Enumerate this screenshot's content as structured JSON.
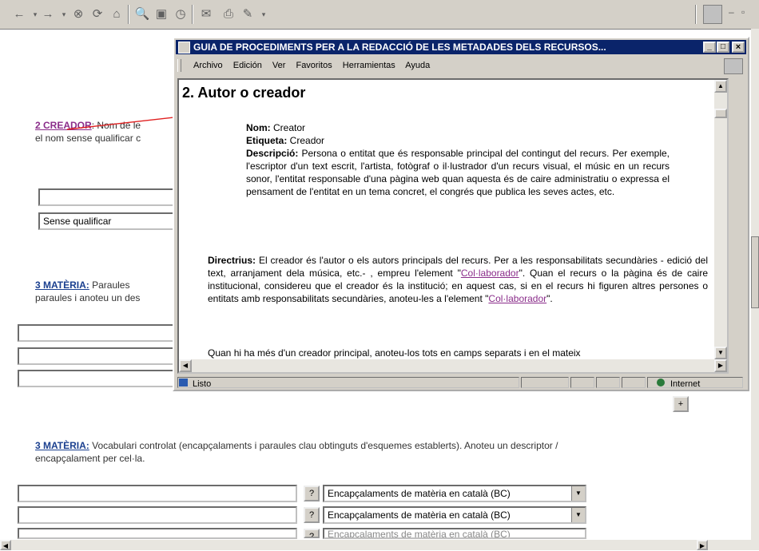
{
  "outer_toolbar": {
    "back_icon": "←",
    "forward_icon": "→",
    "stop_icon": "⊗",
    "refresh_icon": "⟳",
    "home_icon": "⌂",
    "search_icon": "🔍",
    "favorites_icon": "▣",
    "history_icon": "◷",
    "mail_icon": "✉",
    "print_icon": "⎙",
    "edit_icon": "✎",
    "minimize": "–",
    "restore": "▫"
  },
  "page": {
    "creador_link": "2 CREADOR",
    "creador_text": ": Nom de le",
    "creador_text2": "el nom sense qualificar c",
    "sense_qualificar": "Sense qualificar",
    "materia_link": "3 MATÈRIA:",
    "materia_text": " Paraules",
    "materia_text2": "paraules i anoteu un des",
    "plus_button": "+",
    "materia2_link": "3 MATÈRIA:",
    "materia2_text": " Vocabulari controlat (encapçalaments i paraules clau obtinguts d'esquemes establerts). Anoteu un descriptor /",
    "materia2_text2": "encapçalament per cel·la.",
    "question_label": "?",
    "select_value": "Encapçalaments de matèria en català (BC)"
  },
  "popup": {
    "title": "GUIA DE PROCEDIMENTS PER A LA REDACCIÓ DE LES METADADES DELS RECURSOS...",
    "menu": [
      "Archivo",
      "Edición",
      "Ver",
      "Favoritos",
      "Herramientas",
      "Ayuda"
    ],
    "heading": "2. Autor o creador",
    "nom_label": "Nom:",
    "nom_value": " Creator",
    "etiqueta_label": "Etiqueta:",
    "etiqueta_value": " Creador",
    "descripcio_label": "Descripció:",
    "descripcio_value": " Persona o entitat que és responsable principal del contingut del recurs. Per exemple, l'escriptor d'un text escrit, l'artista, fotògraf o il·lustrador d'un recurs visual, el músic en un recurs sonor, l'entitat responsable d'una pàgina web quan aquesta és de caire administratiu o expressa el pensament de l'entitat en un tema concret, el congrés que publica les seves actes, etc.",
    "directrius_label": "Directrius:",
    "directrius_a": " El creador és l'autor o els autors principals del recurs. Per a les responsabilitats secundàries - edició del text, arranjament dela música, etc.- , empreu l'element  \"",
    "collab_link": "Col·laborador",
    "directrius_b": "\". Quan el recurs o la pàgina és de caire institucional, considereu que el creador és la institució; en aquest cas, si en el recurs hi figuren altres persones o entitats amb responsabilitats secundàries, anoteu-les a l'element  \"",
    "directrius_c": "\".",
    "quan_text": "Quan hi ha més d'un creador principal, anoteu-los tots en camps separats i en el mateix",
    "status_left": "Listo",
    "status_right": "Internet",
    "min_btn": "_",
    "max_btn": "□",
    "close_btn": "×"
  },
  "colors": {
    "titlebar": "#0a246a",
    "link_blue": "#1a3f8f",
    "link_purple": "#8a2d8a",
    "arrow": "#e02020"
  }
}
